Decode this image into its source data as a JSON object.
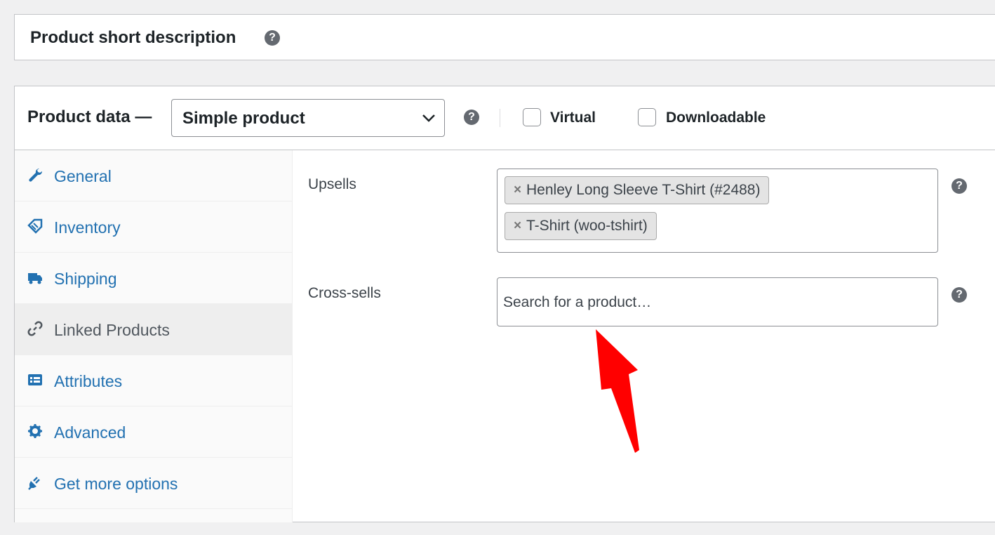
{
  "short_description": {
    "title": "Product short description",
    "help": "?"
  },
  "product_data": {
    "title": "Product data —",
    "product_type": "Simple product",
    "help": "?",
    "virtual_label": "Virtual",
    "downloadable_label": "Downloadable",
    "virtual_checked": false,
    "downloadable_checked": false
  },
  "tabs": [
    {
      "label": "General",
      "icon": "wrench-icon",
      "active": false
    },
    {
      "label": "Inventory",
      "icon": "tag-icon",
      "active": false
    },
    {
      "label": "Shipping",
      "icon": "truck-icon",
      "active": false
    },
    {
      "label": "Linked Products",
      "icon": "link-icon",
      "active": true
    },
    {
      "label": "Attributes",
      "icon": "list-icon",
      "active": false
    },
    {
      "label": "Advanced",
      "icon": "gear-icon",
      "active": false
    },
    {
      "label": "Get more options",
      "icon": "plug-icon",
      "active": false
    }
  ],
  "linked": {
    "upsells_label": "Upsells",
    "upsells": [
      {
        "remove": "×",
        "label": "Henley Long Sleeve T-Shirt (#2488)"
      },
      {
        "remove": "×",
        "label": "T-Shirt (woo-tshirt)"
      }
    ],
    "crosssells_label": "Cross-sells",
    "crosssells_placeholder": "Search for a product…",
    "help": "?"
  },
  "colors": {
    "link": "#2271b1",
    "annotation_arrow": "#ff0000",
    "help_icon": "#646970"
  }
}
